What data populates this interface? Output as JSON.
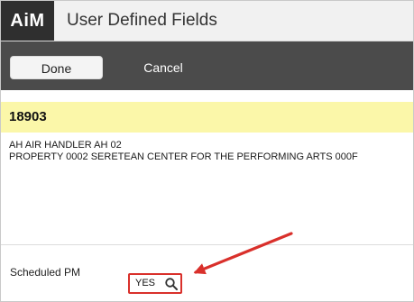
{
  "app": {
    "logo": "AiM",
    "title": "User Defined Fields"
  },
  "toolbar": {
    "done_label": "Done",
    "cancel_label": "Cancel"
  },
  "record": {
    "id": "18903",
    "description_lines": [
      "AH AIR HANDLER AH 02",
      "PROPERTY 0002 SERETEAN CENTER FOR THE PERFORMING ARTS 000F"
    ]
  },
  "fields": {
    "scheduled_pm": {
      "label": "Scheduled PM",
      "value": "YES",
      "lookup_icon": "search-icon"
    }
  },
  "colors": {
    "toolbar_bg": "#4b4b4b",
    "logo_bg": "#2f2f2f",
    "record_highlight": "#fbf7a9",
    "annotation_red": "#d9302b"
  }
}
